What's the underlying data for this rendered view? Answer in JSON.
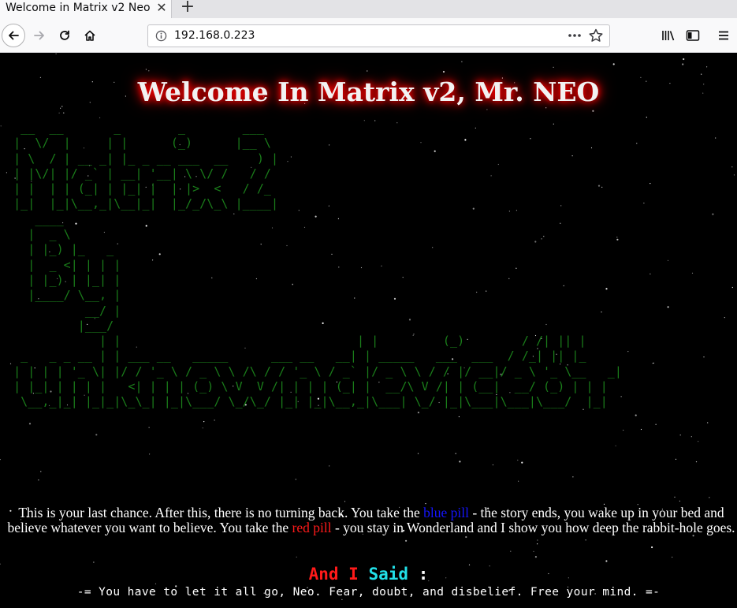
{
  "browser": {
    "tab_title": "Welcome in Matrix v2 Neo",
    "tab_close_glyph": "✕",
    "new_tab_glyph": "+",
    "url": "192.168.0.223",
    "url_more_glyph": "•••"
  },
  "page": {
    "title": "Welcome In Matrix v2, Mr. NEO",
    "ascii_art": "  __  __       _        _        ___\n |  \\/  |     | |      (_)      |__ \\\n | \\  / | __ _| |_ _ __ ___  __    ) |\n | |\\/| |/ _` | __| '__| \\ \\/ /   / /\n | |  | | (_| | |_| |  | |>  <   / /_\n |_|  |_|\\__,_|\\__|_|  |_/_/\\_\\ |____|\n    ____\n   |  _ \\\n   | |_) |_   _\n   |  _ <| | | |\n   | |_) | |_| |\n   |____/ \\__, |\n           __/ |\n          |___/\n             | |                                 | |         (_)        / /| || |\n  _   _ _ __ | | ___ __   _____      ___ __   __| | _____   ___  ___  / /_| || |_\n | | | | '_ \\| |/ / '_ \\ / _ \\ \\ /\\ / / '_ \\ / _` |/ _ \\ \\ / / |/ __|/ _ \\ '_ \\__   _|\n | |_| | | | |   <| | | | (_) \\ V  V /| | | | (_| |  __/\\ V /| | (__|  __/ (_) | | |\n  \\__,_|_| |_|_|\\_\\_| |_|\\___/ \\_/\\_/ |_| |_|\\__,_|\\___| \\_/ |_|\\___|\\___|\\___/  |_|",
    "intro": {
      "part1": "This is your last chance. After this, there is no turning back. You take the ",
      "blue_pill": "blue pill",
      "part2": " - the story ends, you wake up in your bed and believe whatever you want to believe. You take the ",
      "red_pill": "red pill",
      "part3": " - you stay in Wonderland and I show you how deep the rabbit-hole goes."
    },
    "said": {
      "and_i": "And I",
      "said_word": "Said",
      "colon": ":"
    },
    "quote": "-= You have to let it all go, Neo. Fear, doubt, and disbelief. Free your mind. =-"
  },
  "colors": {
    "ascii_green": "#1a7d1a",
    "title_glow": "#ff0000",
    "blue_pill": "#1515ff",
    "red_pill": "#ff1a1a",
    "said_cyan": "#22e0e8",
    "background": "#000000"
  },
  "icons": {
    "back": "back-arrow-icon",
    "forward": "forward-arrow-icon",
    "reload": "reload-icon",
    "home": "home-icon",
    "info": "info-icon",
    "more": "page-actions-icon",
    "bookmark": "star-icon",
    "library": "library-icon",
    "sidebar": "sidebar-icon",
    "menu": "hamburger-menu-icon"
  }
}
